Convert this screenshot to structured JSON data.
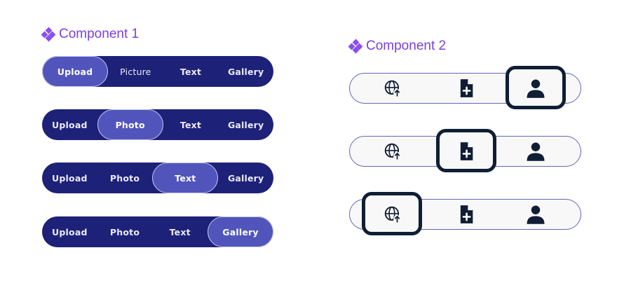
{
  "component1": {
    "title": "Component 1",
    "rows": [
      {
        "options": [
          "Upload",
          "Picture",
          "Text",
          "Gallery"
        ],
        "active": 0
      },
      {
        "options": [
          "Upload",
          "Photo",
          "Text",
          "Gallery"
        ],
        "active": 1
      },
      {
        "options": [
          "Upload",
          "Photo",
          "Text",
          "Gallery"
        ],
        "active": 2
      },
      {
        "options": [
          "Upload",
          "Photo",
          "Text",
          "Gallery"
        ],
        "active": 3
      }
    ]
  },
  "component2": {
    "title": "Component 2",
    "icons": [
      "globe-upload-icon",
      "file-plus-icon",
      "user-icon"
    ],
    "rows": [
      {
        "active": 2
      },
      {
        "active": 1
      },
      {
        "active": 0
      }
    ]
  },
  "colors": {
    "title": "#7b3fe0",
    "segment_bg": "#1e2178",
    "segment_active": "#5155bb",
    "icon": "#0f1e34",
    "bar_border": "#6266b8"
  }
}
